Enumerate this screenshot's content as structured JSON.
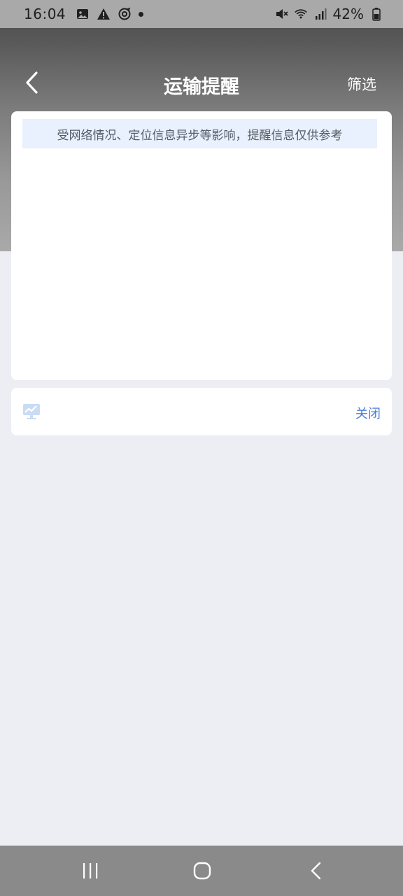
{
  "status_bar": {
    "time": "16:04",
    "battery": "42%",
    "icons": [
      "gallery-icon",
      "warning-icon",
      "sync-icon",
      "notification-dot",
      "mute-icon",
      "wifi-icon",
      "signal-icon",
      "battery-icon"
    ]
  },
  "header": {
    "title": "运输提醒",
    "filter_label": "筛选",
    "back_icon": "chevron-left-icon"
  },
  "notice": {
    "text": "受网络情况、定位信息异步等影响，提醒信息仅供参考"
  },
  "tool_card": {
    "icon": "chart-monitor-icon",
    "close_label": "关闭"
  },
  "bottom_nav": {
    "icons": [
      "recents-icon",
      "home-icon",
      "back-icon"
    ]
  },
  "colors": {
    "accent": "#4a7fd4",
    "notice_bg": "#e8f1fd",
    "page_bg": "#eceef3"
  }
}
